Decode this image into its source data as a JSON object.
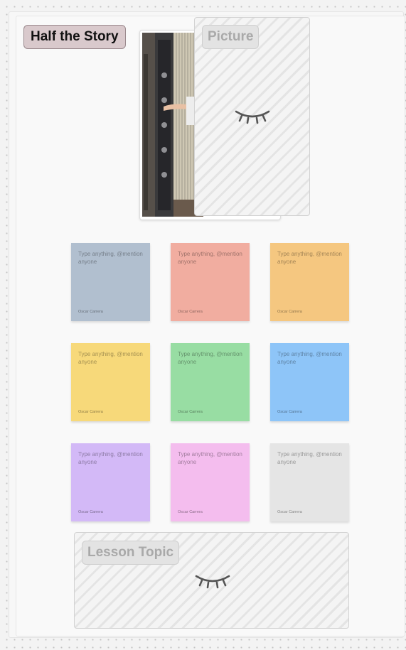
{
  "board": {
    "title": "Half the Story"
  },
  "picture_block": {
    "label": "Picture",
    "icon": "eye-closed-icon"
  },
  "lesson_block": {
    "label": "Lesson Topic",
    "icon": "eye-closed-icon"
  },
  "sticky_notes": [
    {
      "placeholder": "Type anything, @mention anyone",
      "author": "Oscar Carrera",
      "color": "#b1bfcf"
    },
    {
      "placeholder": "Type anything, @mention anyone",
      "author": "Oscar Carrera",
      "color": "#f1ada0"
    },
    {
      "placeholder": "Type anything, @mention anyone",
      "author": "Oscar Carrera",
      "color": "#f5c780"
    },
    {
      "placeholder": "Type anything, @mention anyone",
      "author": "Oscar Carrera",
      "color": "#f7d97a"
    },
    {
      "placeholder": "Type anything, @mention anyone",
      "author": "Oscar Carrera",
      "color": "#98dda3"
    },
    {
      "placeholder": "Type anything, @mention anyone",
      "author": "Oscar Carrera",
      "color": "#8ec5f8"
    },
    {
      "placeholder": "Type anything, @mention anyone",
      "author": "Oscar Carrera",
      "color": "#d3b9f7"
    },
    {
      "placeholder": "Type anything, @mention anyone",
      "author": "Oscar Carrera",
      "color": "#f4bdee"
    },
    {
      "placeholder": "Type anything, @mention anyone",
      "author": "Oscar Carrera",
      "color": "#e5e5e5"
    }
  ]
}
